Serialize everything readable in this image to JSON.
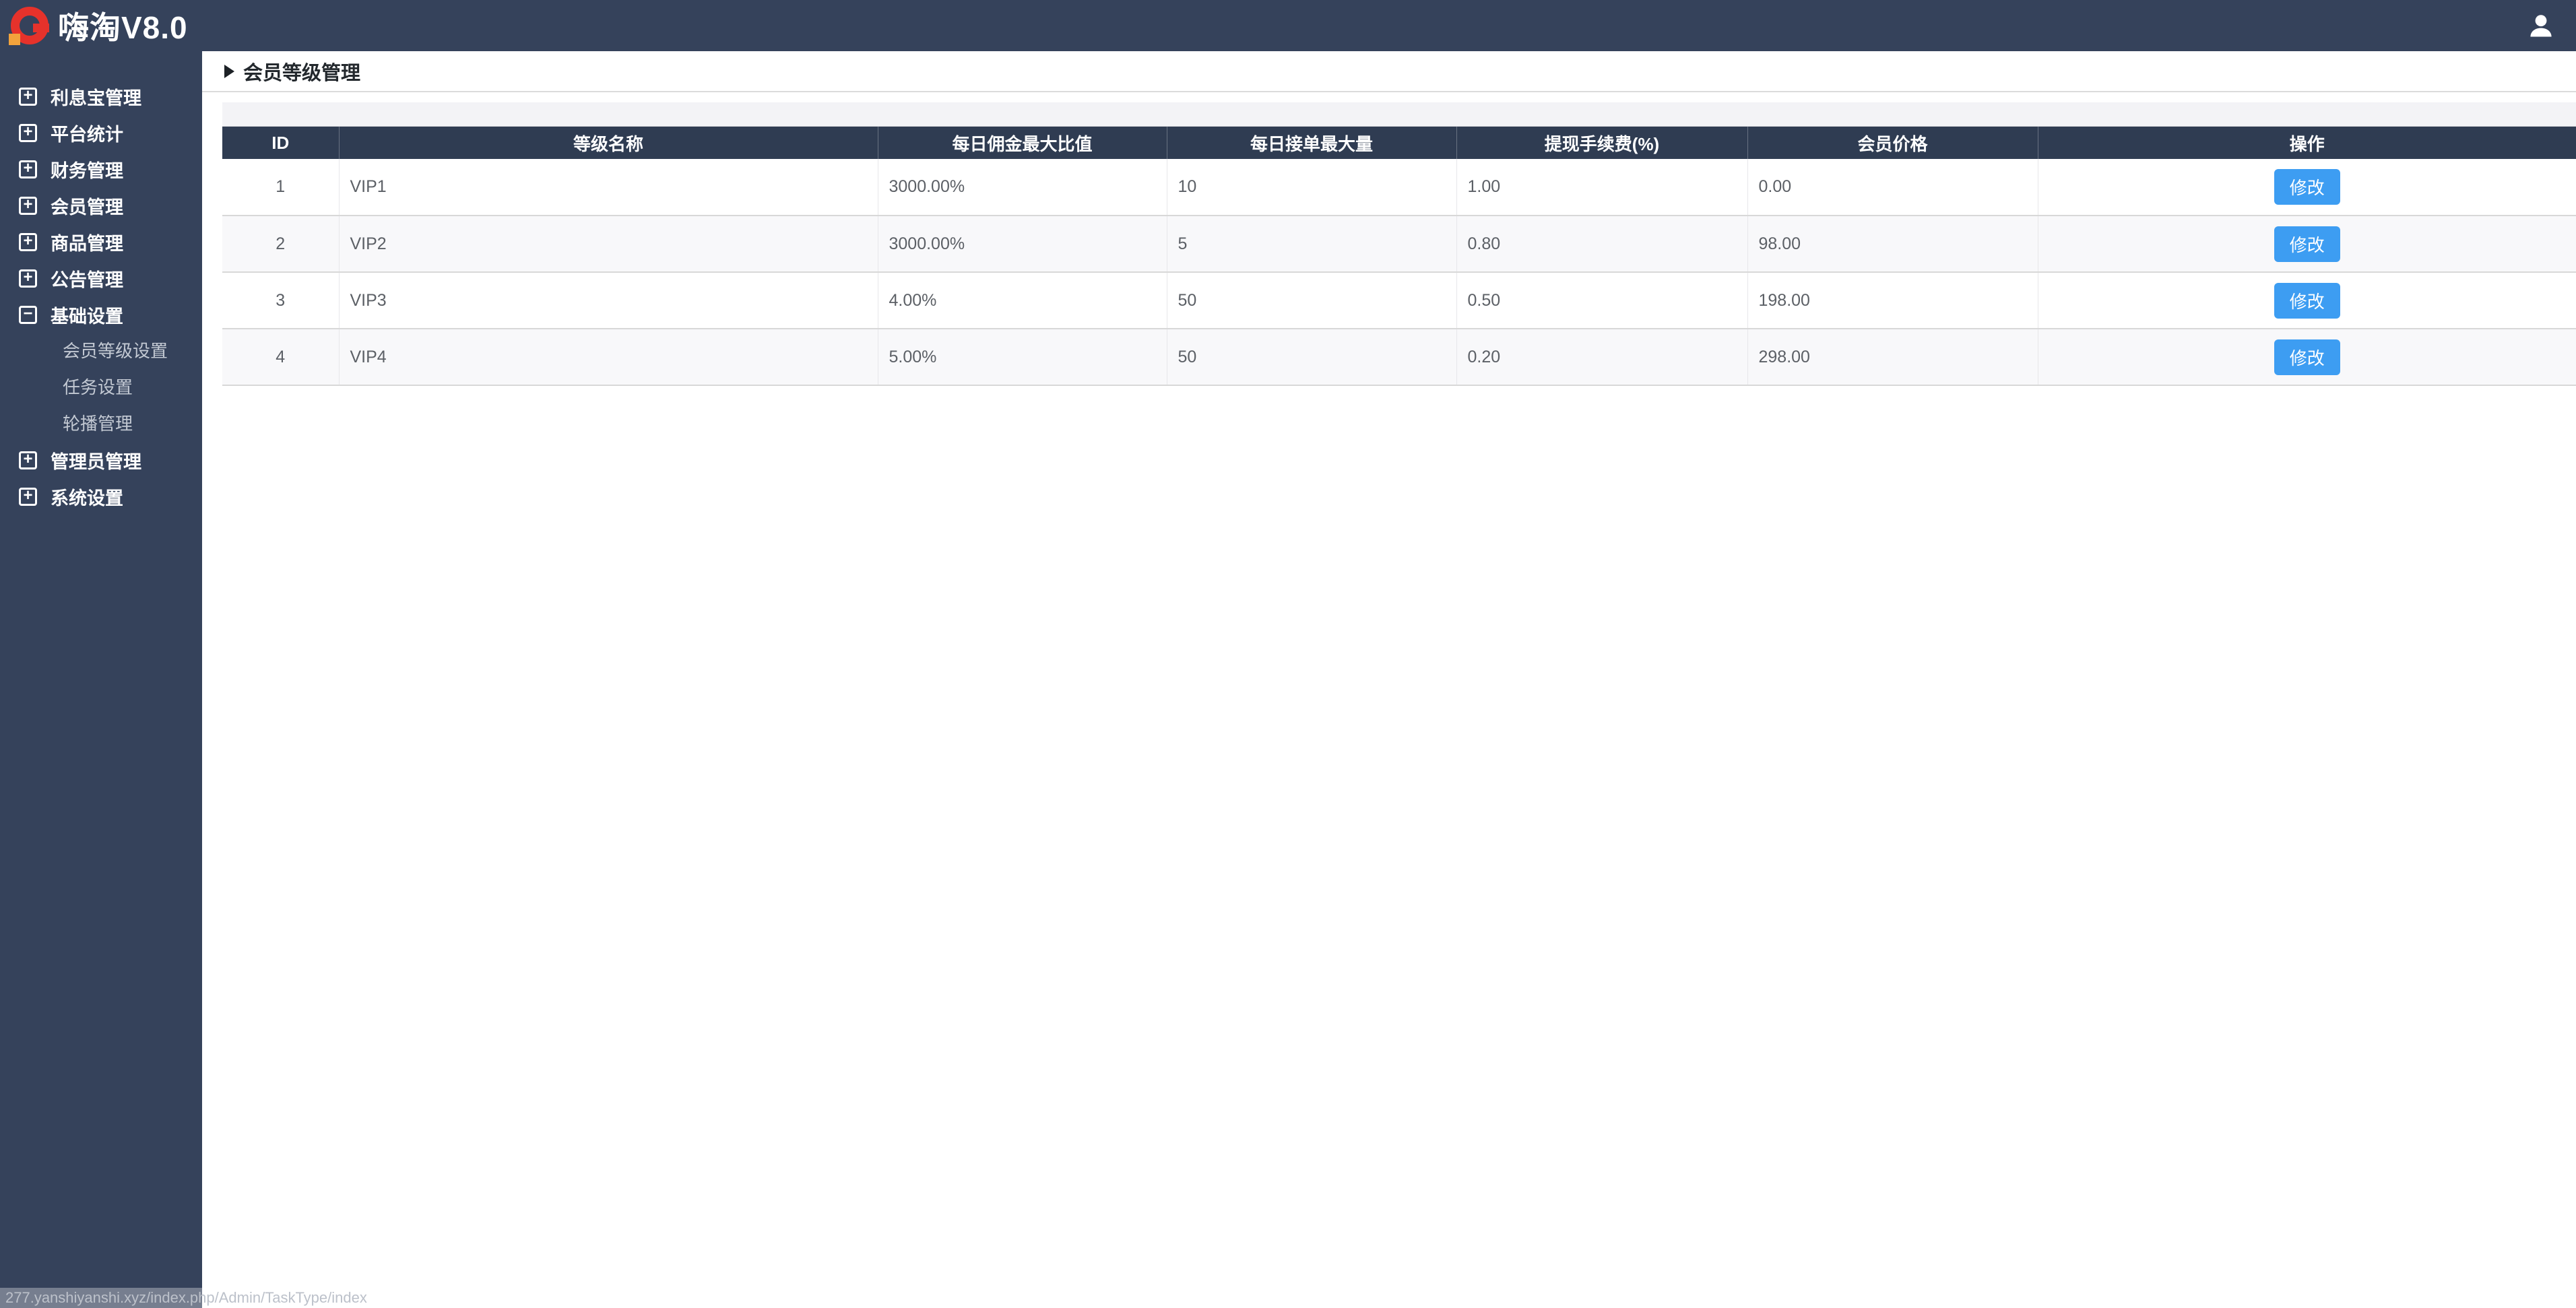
{
  "app": {
    "title": "嗨淘V8.0"
  },
  "colors": {
    "header_navy": "#35425B",
    "table_header_navy": "#2F3C52",
    "accent_blue": "#3D9DF2",
    "logo_red": "#E6322B",
    "logo_orange": "#F2A33C"
  },
  "sidebar": {
    "active_subitem": "会员等级设置",
    "items": [
      {
        "label": "利息宝管理",
        "state": "collapsed"
      },
      {
        "label": "平台统计",
        "state": "collapsed"
      },
      {
        "label": "财务管理",
        "state": "collapsed"
      },
      {
        "label": "会员管理",
        "state": "collapsed"
      },
      {
        "label": "商品管理",
        "state": "collapsed"
      },
      {
        "label": "公告管理",
        "state": "collapsed"
      },
      {
        "label": "基础设置",
        "state": "expanded",
        "children": [
          "会员等级设置",
          "任务设置",
          "轮播管理"
        ]
      },
      {
        "label": "管理员管理",
        "state": "collapsed"
      },
      {
        "label": "系统设置",
        "state": "collapsed"
      }
    ]
  },
  "page": {
    "title": "会员等级管理"
  },
  "table": {
    "columns": [
      "ID",
      "等级名称",
      "每日佣金最大比值",
      "每日接单最大量",
      "提现手续费(%)",
      "会员价格",
      "操作"
    ],
    "action_label": "修改",
    "rows": [
      {
        "id": "1",
        "name": "VIP1",
        "max_commission": "3000.00%",
        "max_orders": "10",
        "withdraw_fee": "1.00",
        "price": "0.00"
      },
      {
        "id": "2",
        "name": "VIP2",
        "max_commission": "3000.00%",
        "max_orders": "5",
        "withdraw_fee": "0.80",
        "price": "98.00"
      },
      {
        "id": "3",
        "name": "VIP3",
        "max_commission": "4.00%",
        "max_orders": "50",
        "withdraw_fee": "0.50",
        "price": "198.00"
      },
      {
        "id": "4",
        "name": "VIP4",
        "max_commission": "5.00%",
        "max_orders": "50",
        "withdraw_fee": "0.20",
        "price": "298.00"
      }
    ]
  },
  "statusbar": {
    "url": "277.yanshiyanshi.xyz/index.php/Admin/TaskType/index"
  }
}
